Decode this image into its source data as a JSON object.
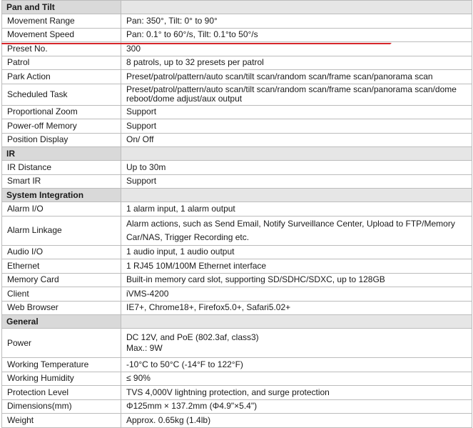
{
  "pan_tilt": {
    "section": "Pan and Tilt",
    "rows": [
      {
        "label": "Movement Range",
        "value": "Pan: 350°, Tilt: 0° to 90°"
      },
      {
        "label": "Movement Speed",
        "value": "Pan: 0.1° to 60°/s, Tilt: 0.1°to 50°/s"
      },
      {
        "label": "Preset No.",
        "value": "300"
      },
      {
        "label": "Patrol",
        "value": "8 patrols, up to 32 presets per patrol"
      },
      {
        "label": "Park Action",
        "value": "Preset/patrol/pattern/auto scan/tilt scan/random scan/frame scan/panorama scan"
      },
      {
        "label": "Scheduled Task",
        "value": "Preset/patrol/pattern/auto scan/tilt scan/random scan/frame scan/panorama scan/dome reboot/dome adjust/aux output"
      },
      {
        "label": "Proportional Zoom",
        "value": "Support"
      },
      {
        "label": "Power-off Memory",
        "value": "Support"
      },
      {
        "label": "Position Display",
        "value": "On/ Off"
      }
    ]
  },
  "ir": {
    "section": "IR",
    "rows": [
      {
        "label": "IR Distance",
        "value": "Up to 30m"
      },
      {
        "label": "Smart IR",
        "value": "Support"
      }
    ]
  },
  "system": {
    "section": "System Integration",
    "rows": [
      {
        "label": "Alarm I/O",
        "value": "1 alarm input, 1 alarm output"
      },
      {
        "label": "Alarm Linkage",
        "value": "Alarm actions, such as Send Email, Notify Surveillance Center, Upload to FTP/Memory Car/NAS, Trigger Recording etc."
      },
      {
        "label": "Audio I/O",
        "value": "1 audio input, 1 audio output"
      },
      {
        "label": "Ethernet",
        "value": "1 RJ45 10M/100M Ethernet interface"
      },
      {
        "label": "Memory Card",
        "value": "Built-in memory card slot, supporting SD/SDHC/SDXC, up to 128GB"
      },
      {
        "label": "Client",
        "value": "iVMS-4200"
      },
      {
        "label": "Web Browser",
        "value": "IE7+, Chrome18+, Firefox5.0+, Safari5.02+"
      }
    ]
  },
  "general": {
    "section": "General",
    "power": {
      "label": "Power",
      "line1": "DC 12V, and PoE (802.3af, class3)",
      "line2": "Max.: 9W"
    },
    "rows": [
      {
        "label": "Working Temperature",
        "value": "-10°C to 50°C (-14°F to 122°F)"
      },
      {
        "label": "Working Humidity",
        "value": "≤ 90%"
      },
      {
        "label": "Protection Level",
        "value": "TVS 4,000V lightning protection, and surge protection"
      },
      {
        "label": "Dimensions(mm)",
        "value": "Φ125mm × 137.2mm (Φ4.9\"×5.4\")"
      },
      {
        "label": "Weight",
        "value": "Approx. 0.65kg (1.4lb)"
      }
    ]
  },
  "colors": {
    "highlight_line": "#d7262b",
    "section_bg": "#d9d9d9"
  }
}
